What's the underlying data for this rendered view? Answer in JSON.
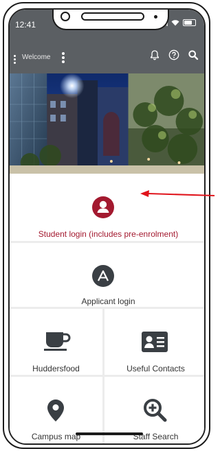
{
  "status_bar": {
    "time": "12:41"
  },
  "app_bar": {
    "welcome": "Welcome",
    "icons": [
      "bell-icon",
      "help-icon",
      "search-icon"
    ]
  },
  "colors": {
    "appbar": "#5b5f63",
    "accent": "#a3192f",
    "icon_dark": "#3a3f44",
    "arrow": "#e0131b"
  },
  "tiles": {
    "student": {
      "label": "Student login (includes pre-enrolment)",
      "icon": "user-circle-icon"
    },
    "applicant": {
      "label": "Applicant login",
      "icon": "applicant-a-icon"
    },
    "food": {
      "label": "Huddersfood",
      "icon": "coffee-cup-icon"
    },
    "contacts": {
      "label": "Useful Contacts",
      "icon": "contact-card-icon"
    },
    "map": {
      "label": "Campus map",
      "icon": "map-pin-icon"
    },
    "staff": {
      "label": "Staff Search",
      "icon": "zoom-plus-icon"
    }
  }
}
